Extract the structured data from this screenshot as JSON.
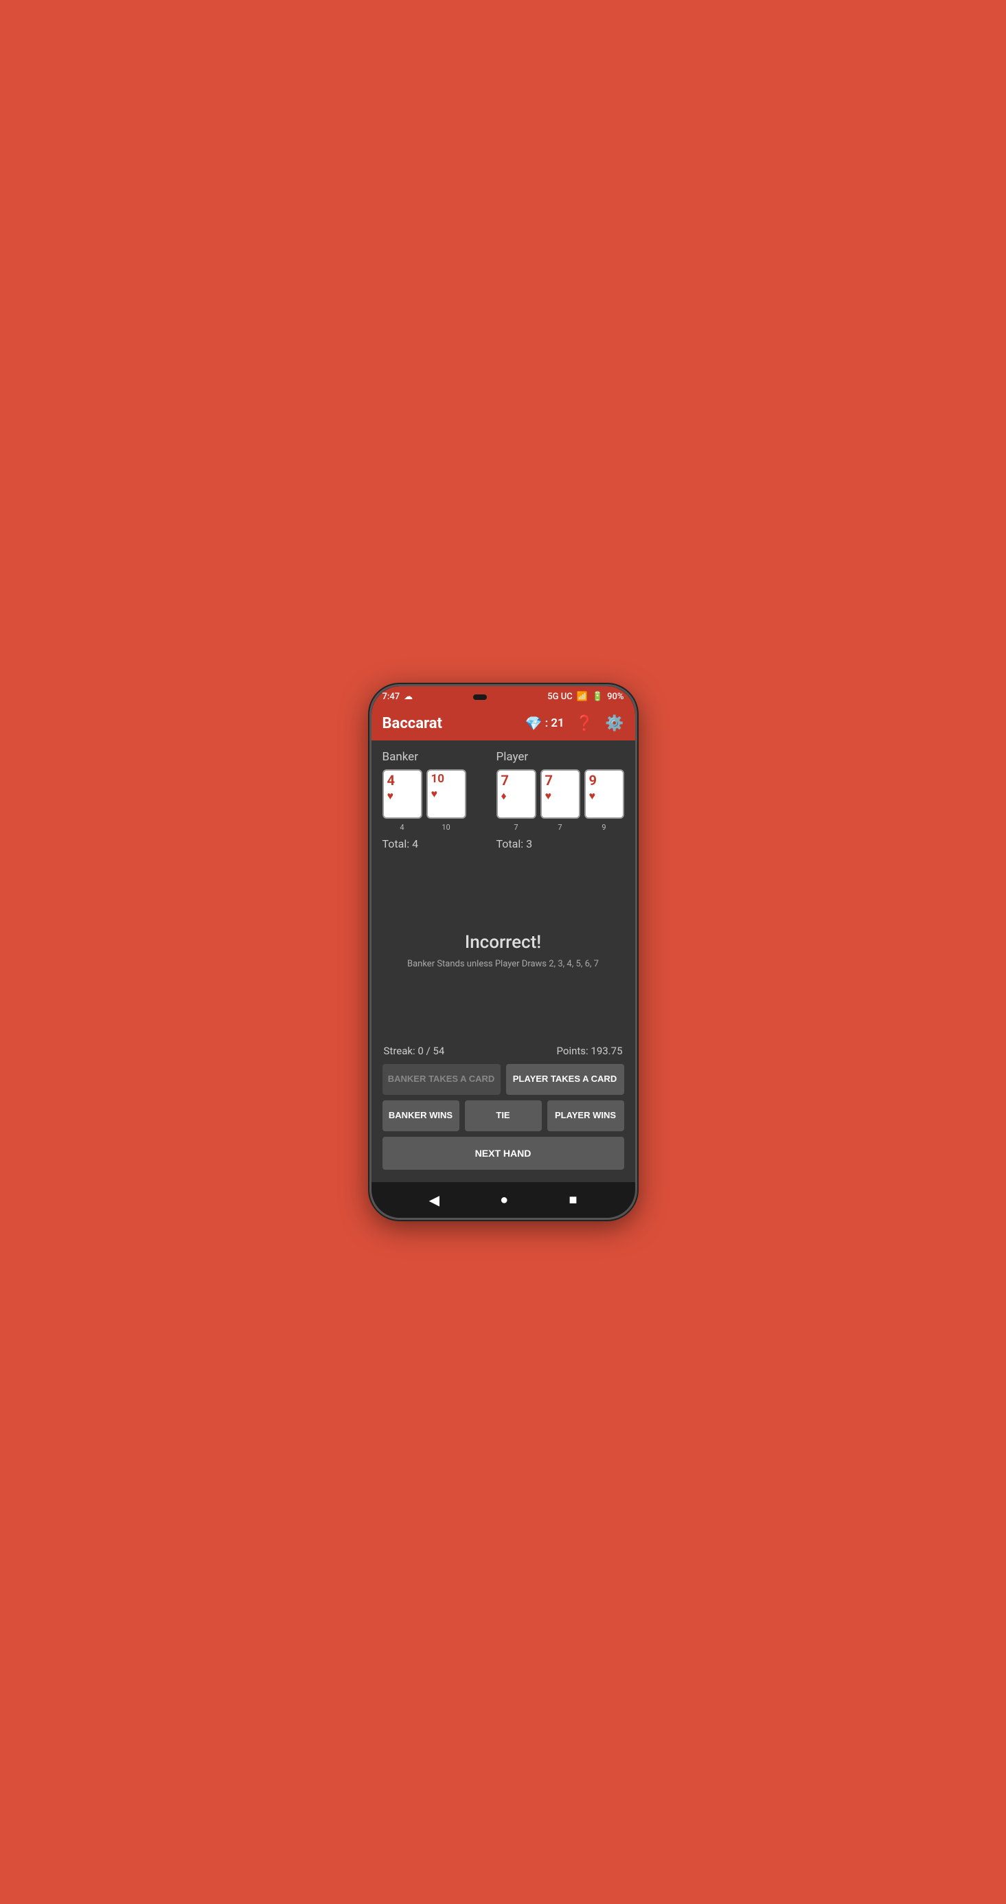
{
  "status_bar": {
    "time": "7:47",
    "network": "5G UC",
    "battery": "90%"
  },
  "app_bar": {
    "title": "Baccarat",
    "gem_score": "21",
    "help_label": "help",
    "settings_label": "settings"
  },
  "banker": {
    "label": "Banker",
    "cards": [
      {
        "value": "4",
        "suit": "♥",
        "number": "4"
      },
      {
        "value": "10",
        "suit": "♥",
        "number": "10"
      }
    ],
    "total_label": "Total: 4"
  },
  "player": {
    "label": "Player",
    "cards": [
      {
        "value": "7",
        "suit": "♦",
        "number": "7"
      },
      {
        "value": "7",
        "suit": "♥",
        "number": "7"
      },
      {
        "value": "9",
        "suit": "♥",
        "number": "9"
      }
    ],
    "total_label": "Total: 3"
  },
  "result": {
    "title": "Incorrect!",
    "subtitle": "Banker Stands unless Player Draws 2, 3, 4, 5, 6, 7"
  },
  "stats": {
    "streak": "Streak: 0 / 54",
    "points": "Points: 193.75"
  },
  "buttons": {
    "banker_takes": "BANKER TAKES A CARD",
    "player_takes": "PLAYER TAKES A CARD",
    "banker_wins": "BANKER WINS",
    "tie": "TIE",
    "player_wins": "PLAYER WINS",
    "next_hand": "NEXT HAND"
  },
  "nav": {
    "back": "◀",
    "home": "●",
    "recent": "■"
  }
}
